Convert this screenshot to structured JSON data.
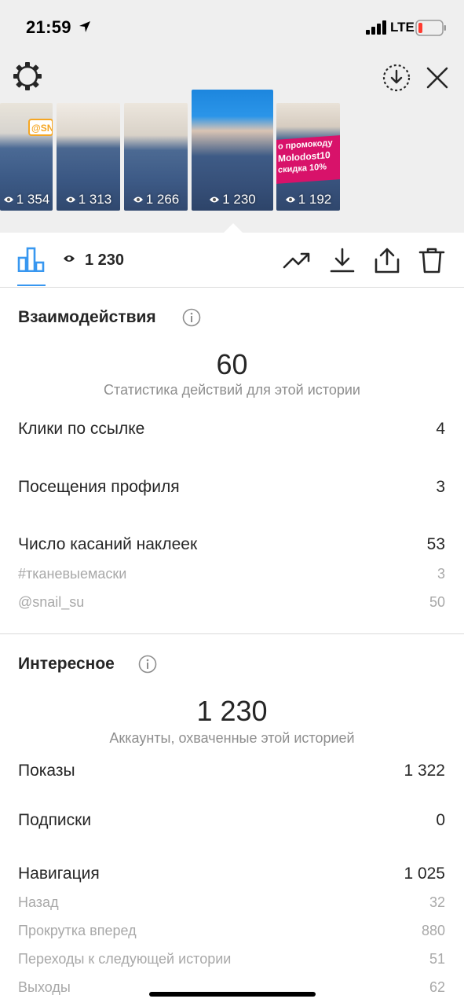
{
  "status": {
    "time": "21:59",
    "network": "LTE"
  },
  "thumbnails": [
    {
      "views": "1 354",
      "overlay": "@SNA"
    },
    {
      "views": "1 313"
    },
    {
      "views": "1 266"
    },
    {
      "views": "1 230",
      "selected": true
    },
    {
      "views": "1 192",
      "overlay": [
        "о промокоду",
        "Molodost10",
        "скидка 10%"
      ]
    }
  ],
  "toolbar": {
    "view_count": "1 230",
    "icons": [
      "bar-chart-icon",
      "eye-icon",
      "trend-icon",
      "download-icon",
      "share-icon",
      "trash-icon"
    ]
  },
  "interactions": {
    "title": "Взаимодействия",
    "total": "60",
    "caption": "Статистика действий для этой истории",
    "rows": [
      {
        "label": "Клики по ссылке",
        "value": "4"
      },
      {
        "label": "Посещения профиля",
        "value": "3"
      },
      {
        "label": "Число касаний наклеек",
        "value": "53"
      }
    ],
    "subrows": [
      {
        "label": "#тканевыемаски",
        "value": "3"
      },
      {
        "label": "@snail_su",
        "value": "50"
      }
    ]
  },
  "discovery": {
    "title": "Интересное",
    "total": "1 230",
    "caption": "Аккаунты, охваченные этой историей",
    "rows": [
      {
        "label": "Показы",
        "value": "1 322"
      },
      {
        "label": "Подписки",
        "value": "0"
      },
      {
        "label": "Навигация",
        "value": "1 025"
      }
    ],
    "subrows": [
      {
        "label": "Назад",
        "value": "32"
      },
      {
        "label": "Прокрутка вперед",
        "value": "880"
      },
      {
        "label": "Переходы к следующей истории",
        "value": "51"
      },
      {
        "label": "Выходы",
        "value": "62"
      }
    ]
  },
  "colors": {
    "accent": "#3897f0",
    "background_top": "#efefef",
    "secondary_text": "#8e8e8e",
    "pink_banner": "#d8126a"
  }
}
